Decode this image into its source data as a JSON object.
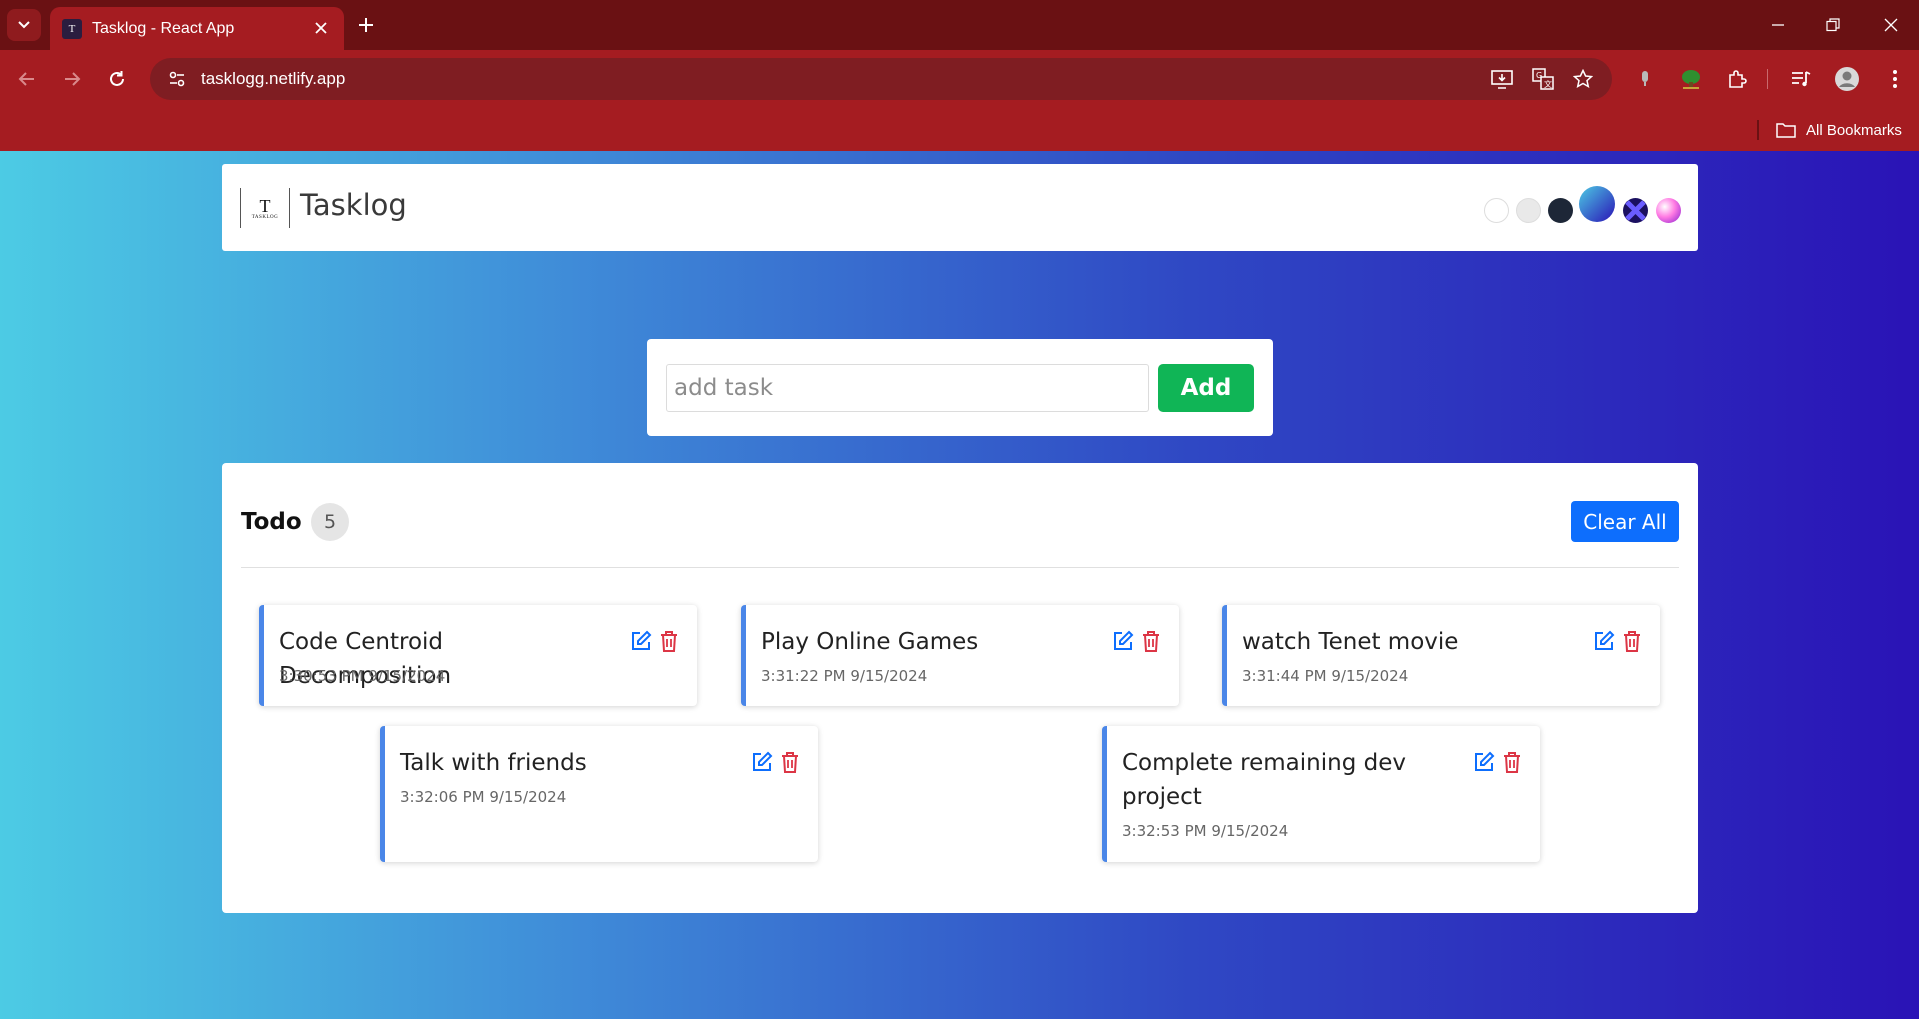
{
  "browser": {
    "tab_title": "Tasklog - React App",
    "favicon_text": "T",
    "url": "tasklogg.netlify.app",
    "bookmarks_label": "All Bookmarks"
  },
  "header": {
    "logo_text": "T",
    "logo_small_text": "TASKLOG",
    "brand": "Tasklog",
    "themes": [
      "white",
      "light-gray",
      "dark-navy",
      "blue-gradient",
      "purple-x",
      "pink-sphere"
    ]
  },
  "add_form": {
    "placeholder": "add task",
    "value": "",
    "button_label": "Add"
  },
  "todo": {
    "title": "Todo",
    "count": "5",
    "clear_label": "Clear All",
    "tasks": [
      {
        "text": "Code Centroid Decomposition",
        "time": "3:30:53 PM 9/15/2024"
      },
      {
        "text": "Play Online Games",
        "time": "3:31:22 PM 9/15/2024"
      },
      {
        "text": "watch Tenet movie",
        "time": "3:31:44 PM 9/15/2024"
      },
      {
        "text": "Talk with friends",
        "time": "3:32:06 PM 9/15/2024"
      },
      {
        "text": "Complete remaining dev project",
        "time": "3:32:53 PM 9/15/2024"
      }
    ]
  },
  "colors": {
    "tabstrip": "#6a1113",
    "toolbar": "#a51c21",
    "add_button": "#10b556",
    "clear_button": "#0d6efd",
    "task_accent": "#4a86e8",
    "delete_icon": "#dc3545",
    "edit_icon": "#0d6efd"
  }
}
